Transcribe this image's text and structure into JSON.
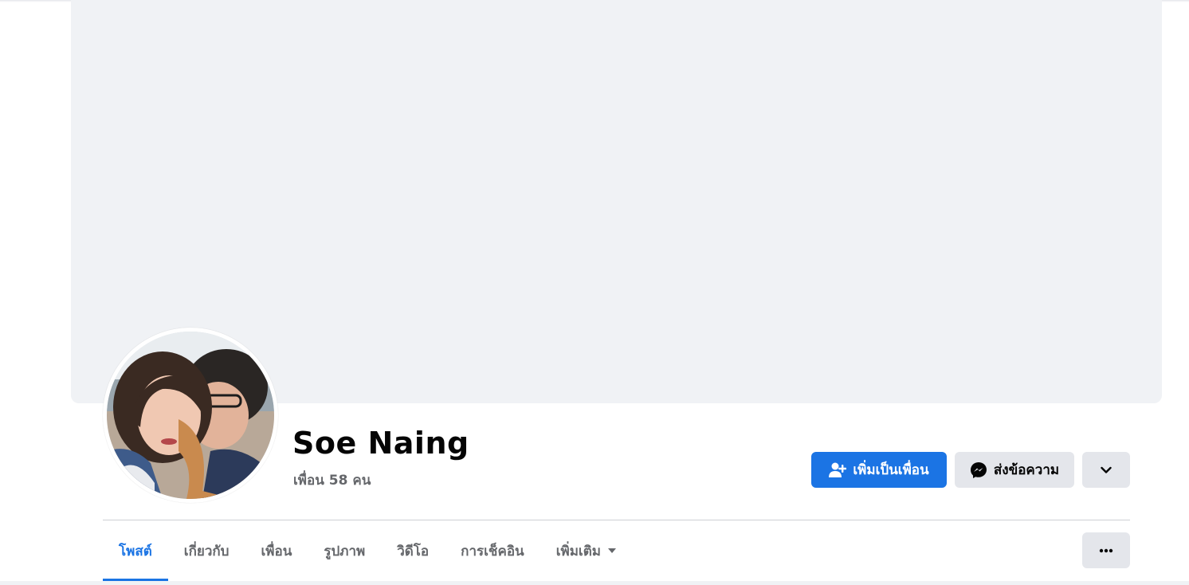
{
  "profile": {
    "name": "Soe Naing",
    "friends_count_text": "เพื่อน 58 คน"
  },
  "actions": {
    "add_friend_label": "เพิ่มเป็นเพื่อน",
    "message_label": "ส่งข้อความ"
  },
  "tabs": [
    {
      "label": "โพสต์",
      "active": true
    },
    {
      "label": "เกี่ยวกับ",
      "active": false
    },
    {
      "label": "เพื่อน",
      "active": false
    },
    {
      "label": "รูปภาพ",
      "active": false
    },
    {
      "label": "วิดีโอ",
      "active": false
    },
    {
      "label": "การเช็คอิน",
      "active": false
    },
    {
      "label": "เพิ่มเติม",
      "active": false
    }
  ],
  "icons": {
    "add_friend": "person-plus-icon",
    "message": "messenger-icon",
    "more_actions": "chevron-down-icon",
    "tab_more_caret": "caret-down-icon",
    "overflow": "ellipsis-icon"
  },
  "colors": {
    "accent": "#1b74e4",
    "cover_bg": "#f0f2f5",
    "secondary_button": "#e4e6eb",
    "muted_text": "#65676b"
  }
}
